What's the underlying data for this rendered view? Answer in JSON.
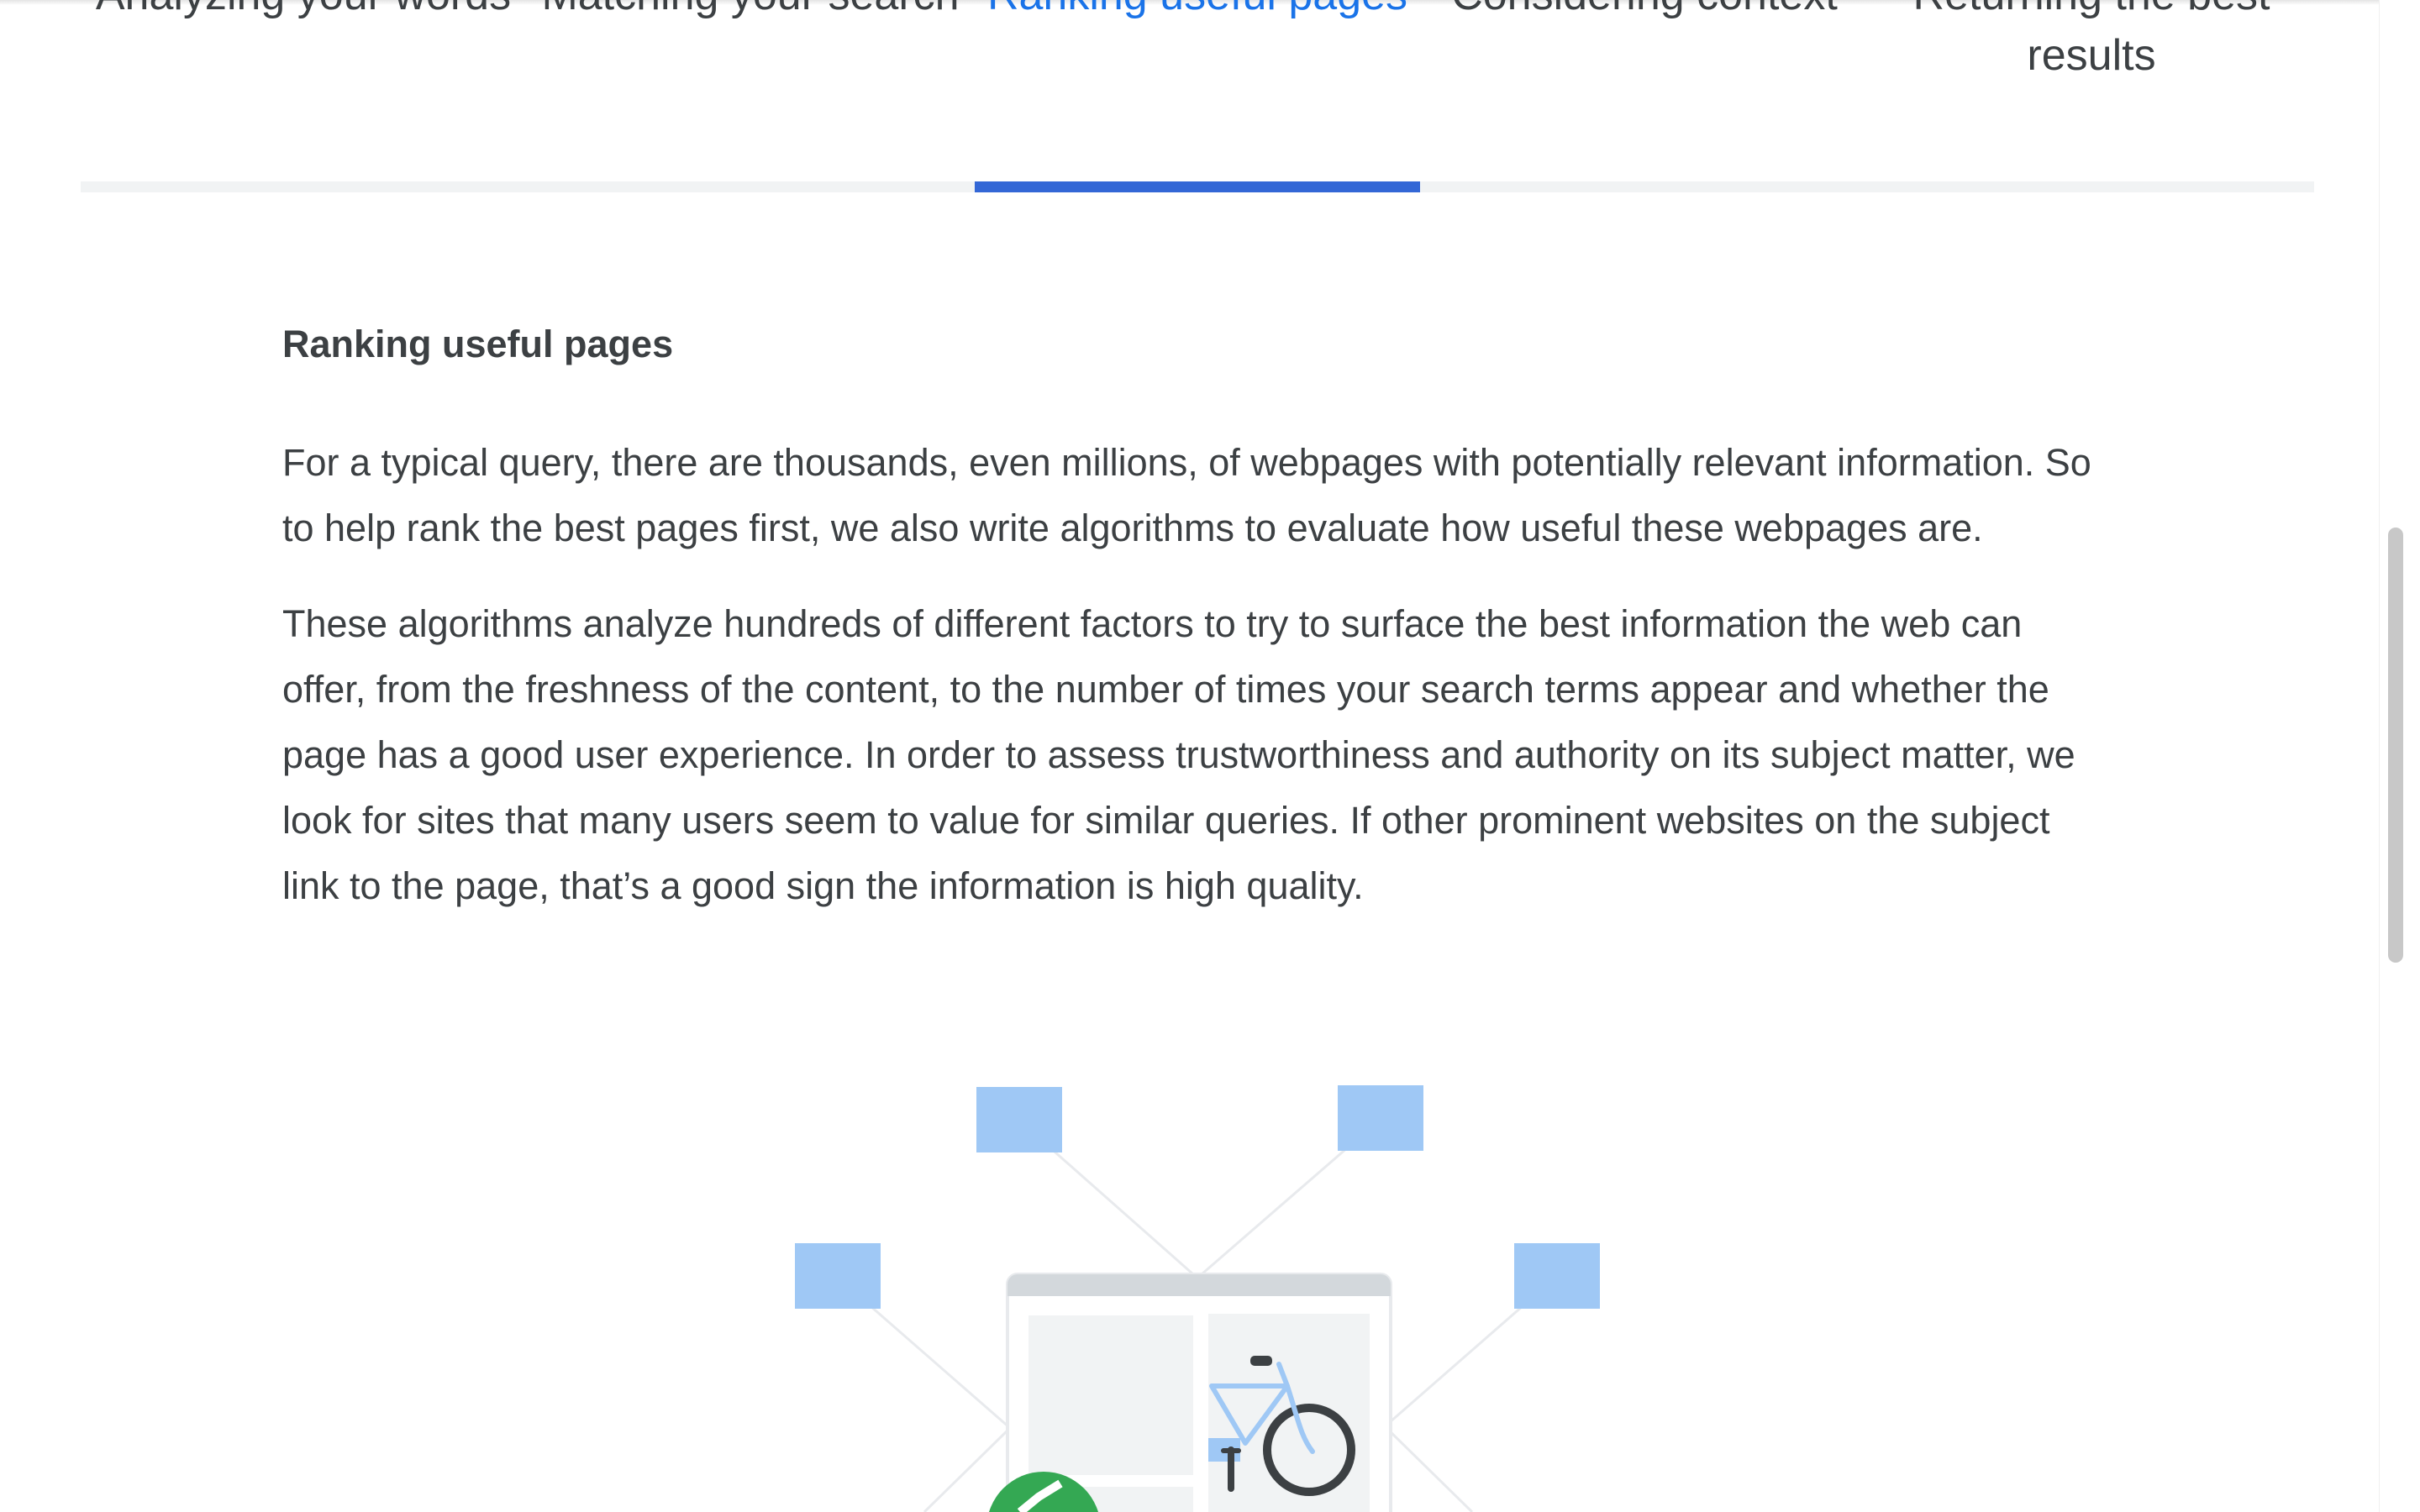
{
  "tabs": [
    {
      "label": "Analyzing your words",
      "active": false
    },
    {
      "label": "Matching your search",
      "active": false
    },
    {
      "label": "Ranking useful pages",
      "active": true
    },
    {
      "label": "Considering context",
      "active": false
    },
    {
      "label": "Returning the best results",
      "active": false
    }
  ],
  "section": {
    "title": "Ranking useful pages",
    "paragraphs": [
      "For a typical query, there are thousands, even millions, of webpages with potentially relevant information. So to help rank the best pages first, we also write algorithms to evaluate how useful these webpages are.",
      "These algorithms analyze hundreds of different factors to try to surface the best information the web can offer, from the freshness of the content, to the number of times your search terms appear and whether the page has a good user experience. In order to assess trustworthiness and authority on its subject matter, we look for sites that many users seem to value for similar queries. If other prominent websites on the subject link to the page, that’s a good sign the information is high quality."
    ]
  },
  "colors": {
    "active_tab": "#1a73e8",
    "tab_indicator": "#3367d6",
    "text": "#3c4043",
    "node_blue": "#9fc8f5",
    "check_green": "#34a853"
  },
  "icons": {
    "illustration": "webpage-with-linked-nodes",
    "bicycle": "bicycle-icon",
    "check": "check-badge-icon"
  }
}
